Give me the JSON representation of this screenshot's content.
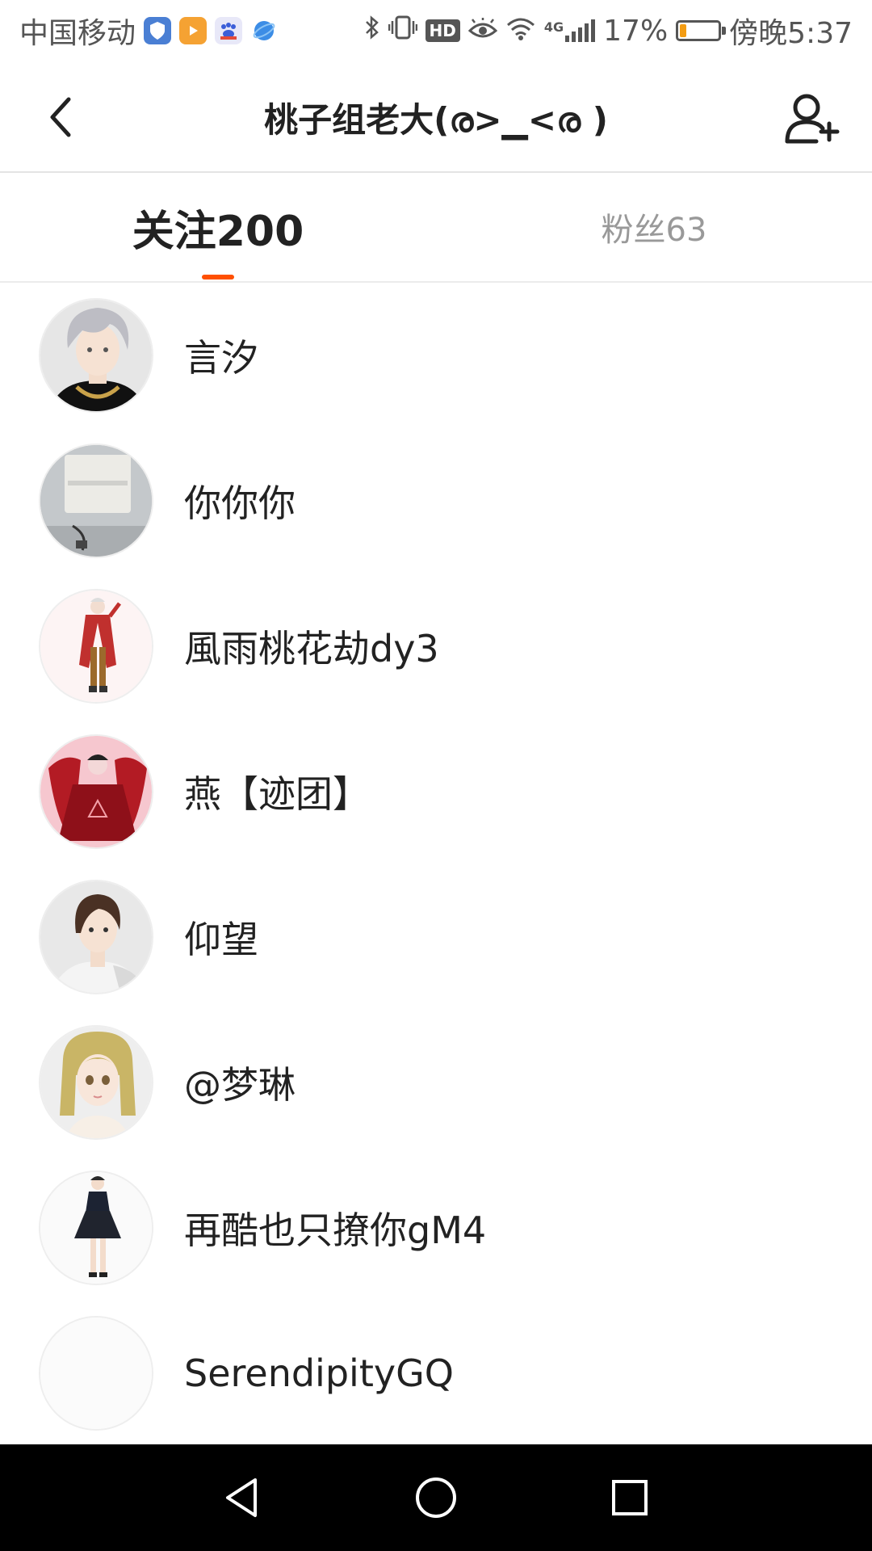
{
  "status_bar": {
    "carrier": "中国移动",
    "network_label": "4G",
    "hd_label": "HD",
    "battery_text": "17%",
    "battery_level": 0.17,
    "time": "傍晚5:37",
    "accent_battery": "#f39c12"
  },
  "header": {
    "title": "桃子组老大(ര>▁<ര )",
    "back_icon": "chevron-left-icon",
    "add_friend_icon": "user-add-icon"
  },
  "tabs": {
    "following_label": "关注200",
    "fans_label": "粉丝63",
    "active_color": "#ff5000"
  },
  "following": [
    {
      "name": "言汐",
      "avatar": "silver-hair-avatar"
    },
    {
      "name": "你你你",
      "avatar": "photo-avatar"
    },
    {
      "name": "風雨桃花劫dy3",
      "avatar": "red-coat-avatar"
    },
    {
      "name": "燕【迹团】",
      "avatar": "red-dress-avatar"
    },
    {
      "name": "仰望",
      "avatar": "brown-hair-avatar"
    },
    {
      "name": "@梦琳",
      "avatar": "blonde-avatar"
    },
    {
      "name": "再酷也只撩你gM4",
      "avatar": "black-dress-avatar"
    },
    {
      "name": "SerendipityGQ",
      "avatar": "blank-avatar"
    }
  ]
}
